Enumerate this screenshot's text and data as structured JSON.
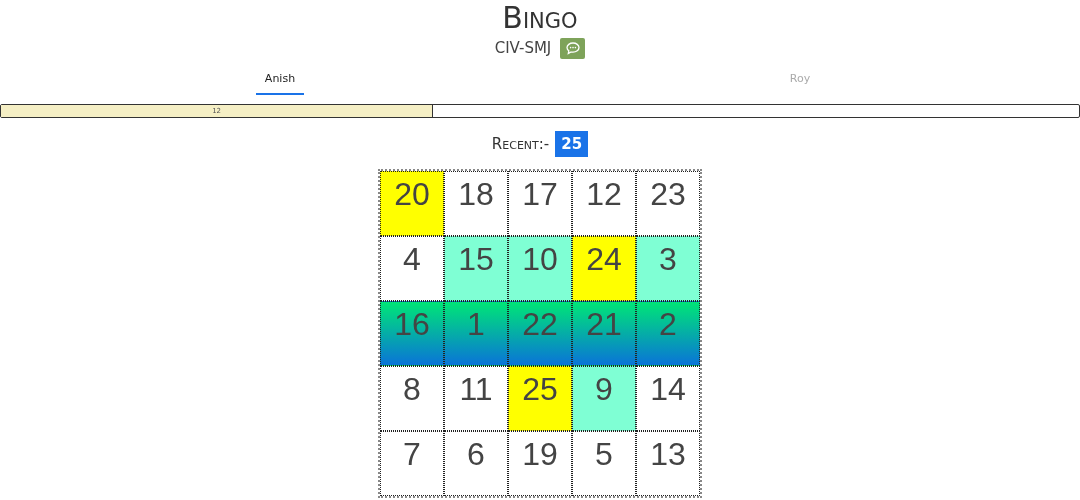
{
  "title": "Bingo",
  "room": {
    "code": "CIV-SMJ"
  },
  "tabs": [
    {
      "label": "Anish",
      "selected": true
    },
    {
      "label": "Roy",
      "selected": false
    }
  ],
  "progress": {
    "level": 0.4,
    "label": "12"
  },
  "recent": {
    "label": "Recent:-",
    "value": "25"
  },
  "board": [
    [
      {
        "n": "20",
        "kind": "mine"
      },
      {
        "n": "18",
        "kind": "open"
      },
      {
        "n": "17",
        "kind": "open"
      },
      {
        "n": "12",
        "kind": "open"
      },
      {
        "n": "23",
        "kind": "open"
      }
    ],
    [
      {
        "n": "4",
        "kind": "open"
      },
      {
        "n": "15",
        "kind": "theirs"
      },
      {
        "n": "10",
        "kind": "theirs"
      },
      {
        "n": "24",
        "kind": "mine"
      },
      {
        "n": "3",
        "kind": "theirs"
      }
    ],
    [
      {
        "n": "16",
        "kind": "line"
      },
      {
        "n": "1",
        "kind": "line"
      },
      {
        "n": "22",
        "kind": "line"
      },
      {
        "n": "21",
        "kind": "line"
      },
      {
        "n": "2",
        "kind": "line"
      }
    ],
    [
      {
        "n": "8",
        "kind": "open"
      },
      {
        "n": "11",
        "kind": "open"
      },
      {
        "n": "25",
        "kind": "mine"
      },
      {
        "n": "9",
        "kind": "theirs"
      },
      {
        "n": "14",
        "kind": "open"
      }
    ],
    [
      {
        "n": "7",
        "kind": "open"
      },
      {
        "n": "6",
        "kind": "open"
      },
      {
        "n": "19",
        "kind": "open"
      },
      {
        "n": "5",
        "kind": "open"
      },
      {
        "n": "13",
        "kind": "open"
      }
    ]
  ]
}
